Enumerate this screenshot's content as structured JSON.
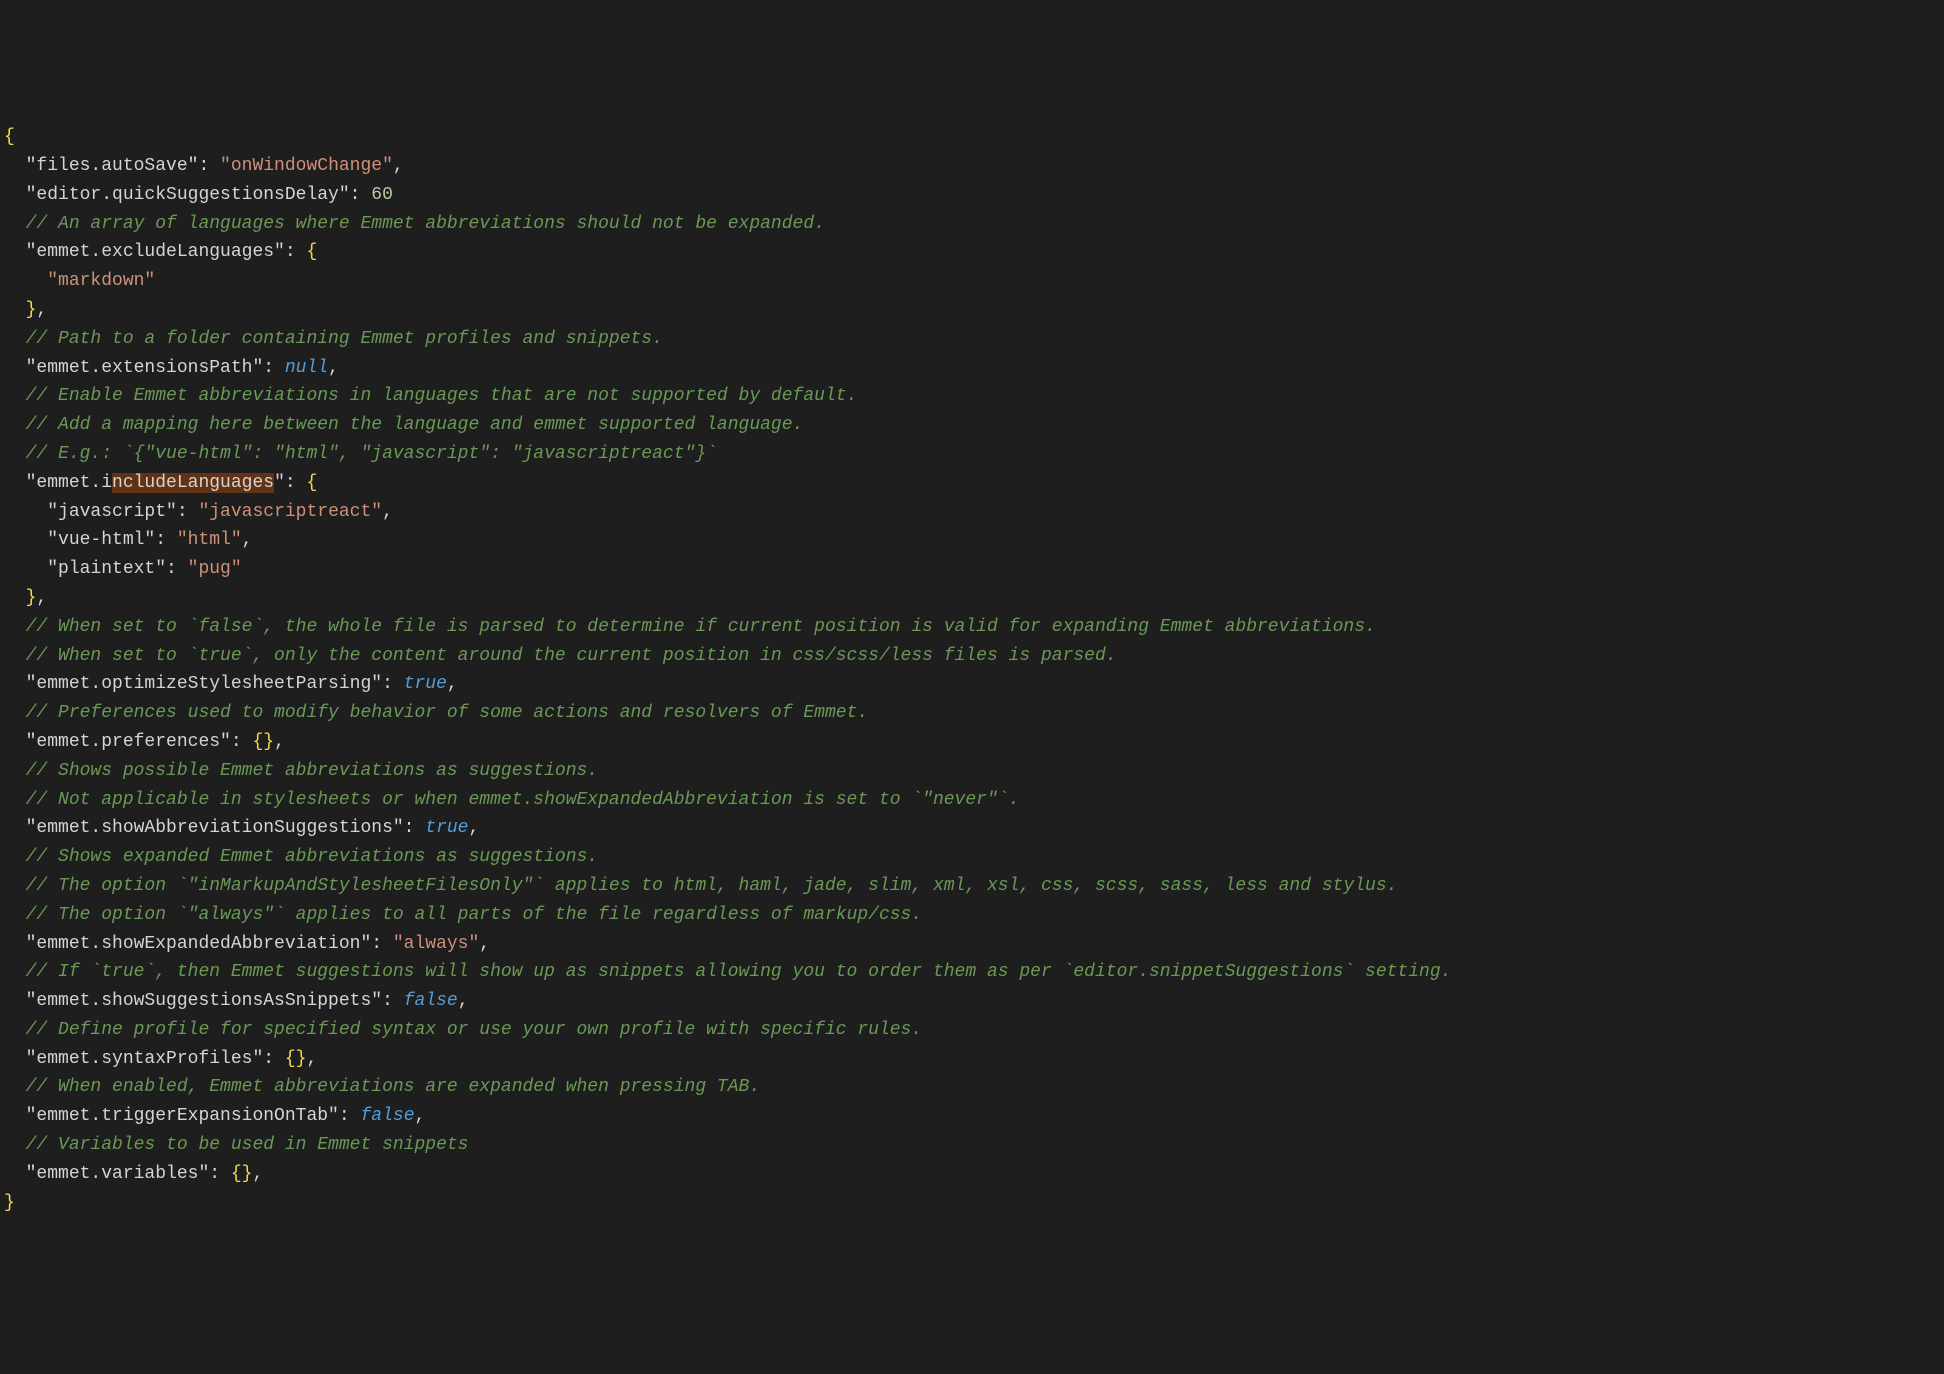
{
  "lines": [
    {
      "type": "brace-open",
      "text": "{"
    },
    {
      "type": "kv",
      "indent": 1,
      "key": "files.autoSave",
      "value": "onWindowChange",
      "valueType": "string",
      "comma": true
    },
    {
      "type": "kv",
      "indent": 1,
      "key": "editor.quickSuggestionsDelay",
      "value": "60",
      "valueType": "number",
      "comma": false
    },
    {
      "type": "comment",
      "indent": 1,
      "text": "// An array of languages where Emmet abbreviations should not be expanded."
    },
    {
      "type": "obj-open",
      "indent": 1,
      "key": "emmet.excludeLanguages"
    },
    {
      "type": "value-only",
      "indent": 2,
      "value": "markdown",
      "valueType": "string",
      "comma": false
    },
    {
      "type": "obj-close",
      "indent": 1,
      "comma": true
    },
    {
      "type": "comment",
      "indent": 1,
      "text": "// Path to a folder containing Emmet profiles and snippets."
    },
    {
      "type": "kv",
      "indent": 1,
      "key": "emmet.extensionsPath",
      "value": "null",
      "valueType": "null",
      "comma": true
    },
    {
      "type": "comment",
      "indent": 1,
      "text": "// Enable Emmet abbreviations in languages that are not supported by default."
    },
    {
      "type": "comment",
      "indent": 1,
      "text": "// Add a mapping here between the language and emmet supported language."
    },
    {
      "type": "comment",
      "indent": 1,
      "text": "// E.g.: `{\"vue-html\": \"html\", \"javascript\": \"javascriptreact\"}`"
    },
    {
      "type": "obj-open",
      "indent": 1,
      "key": "emmet.includeLanguages",
      "highlightStart": 7,
      "highlightEnd": 23
    },
    {
      "type": "kv",
      "indent": 2,
      "key": "javascript",
      "value": "javascriptreact",
      "valueType": "string",
      "comma": true
    },
    {
      "type": "kv",
      "indent": 2,
      "key": "vue-html",
      "value": "html",
      "valueType": "string",
      "comma": true
    },
    {
      "type": "kv",
      "indent": 2,
      "key": "plaintext",
      "value": "pug",
      "valueType": "string",
      "comma": false
    },
    {
      "type": "obj-close",
      "indent": 1,
      "comma": true
    },
    {
      "type": "comment",
      "indent": 1,
      "text": "// When set to `false`, the whole file is parsed to determine if current position is valid for expanding Emmet abbreviations."
    },
    {
      "type": "comment",
      "indent": 1,
      "text": "// When set to `true`, only the content around the current position in css/scss/less files is parsed."
    },
    {
      "type": "kv",
      "indent": 1,
      "key": "emmet.optimizeStylesheetParsing",
      "value": "true",
      "valueType": "bool",
      "comma": true
    },
    {
      "type": "comment",
      "indent": 1,
      "text": "// Preferences used to modify behavior of some actions and resolvers of Emmet."
    },
    {
      "type": "kv-empty-obj",
      "indent": 1,
      "key": "emmet.preferences",
      "comma": true
    },
    {
      "type": "comment",
      "indent": 1,
      "text": "// Shows possible Emmet abbreviations as suggestions."
    },
    {
      "type": "comment",
      "indent": 1,
      "text": "// Not applicable in stylesheets or when emmet.showExpandedAbbreviation is set to `\"never\"`."
    },
    {
      "type": "kv",
      "indent": 1,
      "key": "emmet.showAbbreviationSuggestions",
      "value": "true",
      "valueType": "bool",
      "comma": true
    },
    {
      "type": "comment",
      "indent": 1,
      "text": "// Shows expanded Emmet abbreviations as suggestions."
    },
    {
      "type": "comment",
      "indent": 1,
      "text": "// The option `\"inMarkupAndStylesheetFilesOnly\"` applies to html, haml, jade, slim, xml, xsl, css, scss, sass, less and stylus."
    },
    {
      "type": "comment",
      "indent": 1,
      "text": "// The option `\"always\"` applies to all parts of the file regardless of markup/css."
    },
    {
      "type": "kv",
      "indent": 1,
      "key": "emmet.showExpandedAbbreviation",
      "value": "always",
      "valueType": "string",
      "comma": true
    },
    {
      "type": "comment",
      "indent": 1,
      "text": "// If `true`, then Emmet suggestions will show up as snippets allowing you to order them as per `editor.snippetSuggestions` setting."
    },
    {
      "type": "kv",
      "indent": 1,
      "key": "emmet.showSuggestionsAsSnippets",
      "value": "false",
      "valueType": "bool",
      "comma": true
    },
    {
      "type": "comment",
      "indent": 1,
      "text": "// Define profile for specified syntax or use your own profile with specific rules."
    },
    {
      "type": "kv-empty-obj",
      "indent": 1,
      "key": "emmet.syntaxProfiles",
      "comma": true
    },
    {
      "type": "comment",
      "indent": 1,
      "text": "// When enabled, Emmet abbreviations are expanded when pressing TAB."
    },
    {
      "type": "kv",
      "indent": 1,
      "key": "emmet.triggerExpansionOnTab",
      "value": "false",
      "valueType": "bool",
      "comma": true
    },
    {
      "type": "comment",
      "indent": 1,
      "text": "// Variables to be used in Emmet snippets"
    },
    {
      "type": "kv-empty-obj",
      "indent": 1,
      "key": "emmet.variables",
      "comma": true
    },
    {
      "type": "brace-close",
      "text": "}"
    }
  ]
}
